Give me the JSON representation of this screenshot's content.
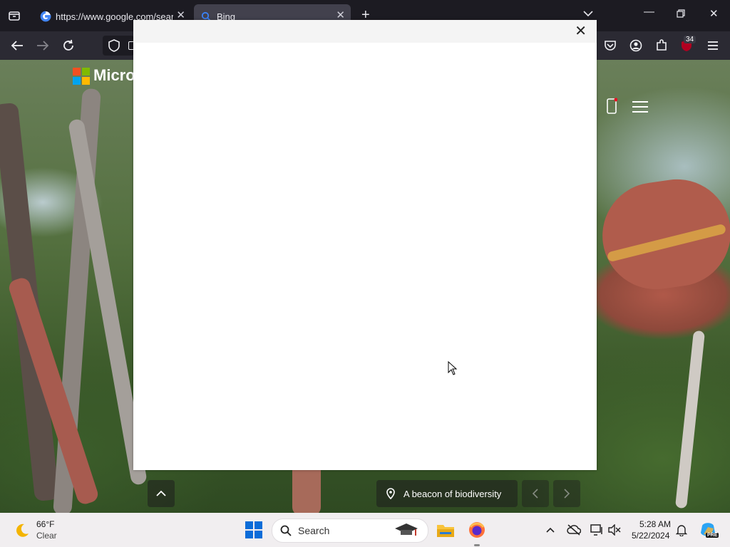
{
  "browser": {
    "tabs": [
      {
        "label": "https://www.google.com/search",
        "active": false
      },
      {
        "label": "Bing",
        "active": true
      }
    ],
    "new_tab_label": "+",
    "extension_badge": "34"
  },
  "page": {
    "brand_text": "Micros",
    "image_caption": "A beacon of biodiversity"
  },
  "taskbar": {
    "weather_temp": "66°F",
    "weather_desc": "Clear",
    "search_placeholder": "Search",
    "time": "5:28 AM",
    "date": "5/22/2024",
    "copilot_badge": "PRE"
  },
  "colors": {
    "tabbar_bg": "#1c1b22",
    "navbar_bg": "#2b2a33",
    "taskbar_bg": "#f1eef0",
    "ms_red": "#f25022",
    "ms_green": "#7fba00",
    "ms_blue": "#00a4ef",
    "ms_yellow": "#ffb900"
  }
}
